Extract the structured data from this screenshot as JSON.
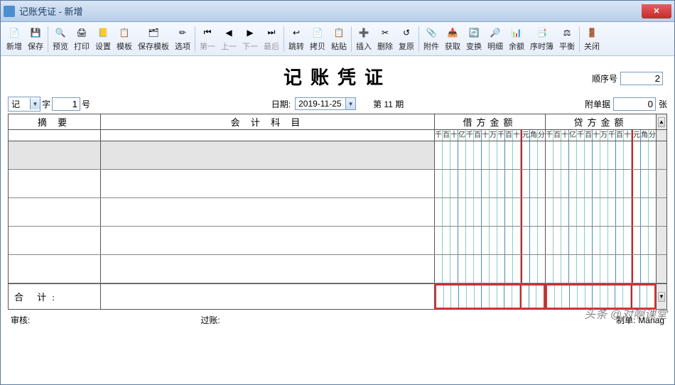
{
  "window": {
    "title": "记账凭证 - 新增",
    "close": "✕"
  },
  "toolbar": [
    {
      "label": "新增",
      "icon": "📄"
    },
    {
      "label": "保存",
      "icon": "💾"
    },
    {
      "sep": true
    },
    {
      "label": "预览",
      "icon": "🔍"
    },
    {
      "label": "打印",
      "icon": "🖨"
    },
    {
      "label": "设置",
      "icon": "📒"
    },
    {
      "label": "模板",
      "icon": "📋"
    },
    {
      "label": "保存模板",
      "icon": "🗂"
    },
    {
      "label": "选项",
      "icon": "✏"
    },
    {
      "sep": true
    },
    {
      "label": "第一",
      "icon": "⏮",
      "disabled": true
    },
    {
      "label": "上一",
      "icon": "◀",
      "disabled": true
    },
    {
      "label": "下一",
      "icon": "▶",
      "disabled": true
    },
    {
      "label": "最后",
      "icon": "⏭",
      "disabled": true
    },
    {
      "sep": true
    },
    {
      "label": "跳转",
      "icon": "↩"
    },
    {
      "label": "拷贝",
      "icon": "📄"
    },
    {
      "label": "粘贴",
      "icon": "📋"
    },
    {
      "sep": true
    },
    {
      "label": "插入",
      "icon": "➕"
    },
    {
      "label": "删除",
      "icon": "✂"
    },
    {
      "label": "复原",
      "icon": "↺"
    },
    {
      "sep": true
    },
    {
      "label": "附件",
      "icon": "📎"
    },
    {
      "label": "获取",
      "icon": "📥"
    },
    {
      "label": "变换",
      "icon": "🔄"
    },
    {
      "label": "明细",
      "icon": "🔎"
    },
    {
      "label": "余额",
      "icon": "📊"
    },
    {
      "label": "序时簿",
      "icon": "📑"
    },
    {
      "label": "平衡",
      "icon": "⚖"
    },
    {
      "sep": true
    },
    {
      "label": "关闭",
      "icon": "🚪"
    }
  ],
  "doc": {
    "title": "记账凭证",
    "type_label": "字",
    "type_value": "记",
    "number": "1",
    "number_suffix": "号",
    "date_label": "日期:",
    "date": "2019-11-25",
    "period": "第 11 期",
    "seq_label": "顺序号",
    "seq": "2",
    "attach_label": "附单据",
    "attach": "0",
    "attach_suffix": "张",
    "headers": {
      "abstract": "摘   要",
      "account": "会 计 科 目",
      "debit": "借方金额",
      "credit": "贷方金额"
    },
    "digits": [
      "千",
      "百",
      "十",
      "亿",
      "千",
      "百",
      "十",
      "万",
      "千",
      "百",
      "十",
      "元",
      "角",
      "分"
    ],
    "total": "合  计:",
    "footer": {
      "audit": "审核:",
      "post": "过账:",
      "prep": "制单:",
      "preparer": "Manag"
    }
  },
  "watermark": "头条 @对啊课堂"
}
